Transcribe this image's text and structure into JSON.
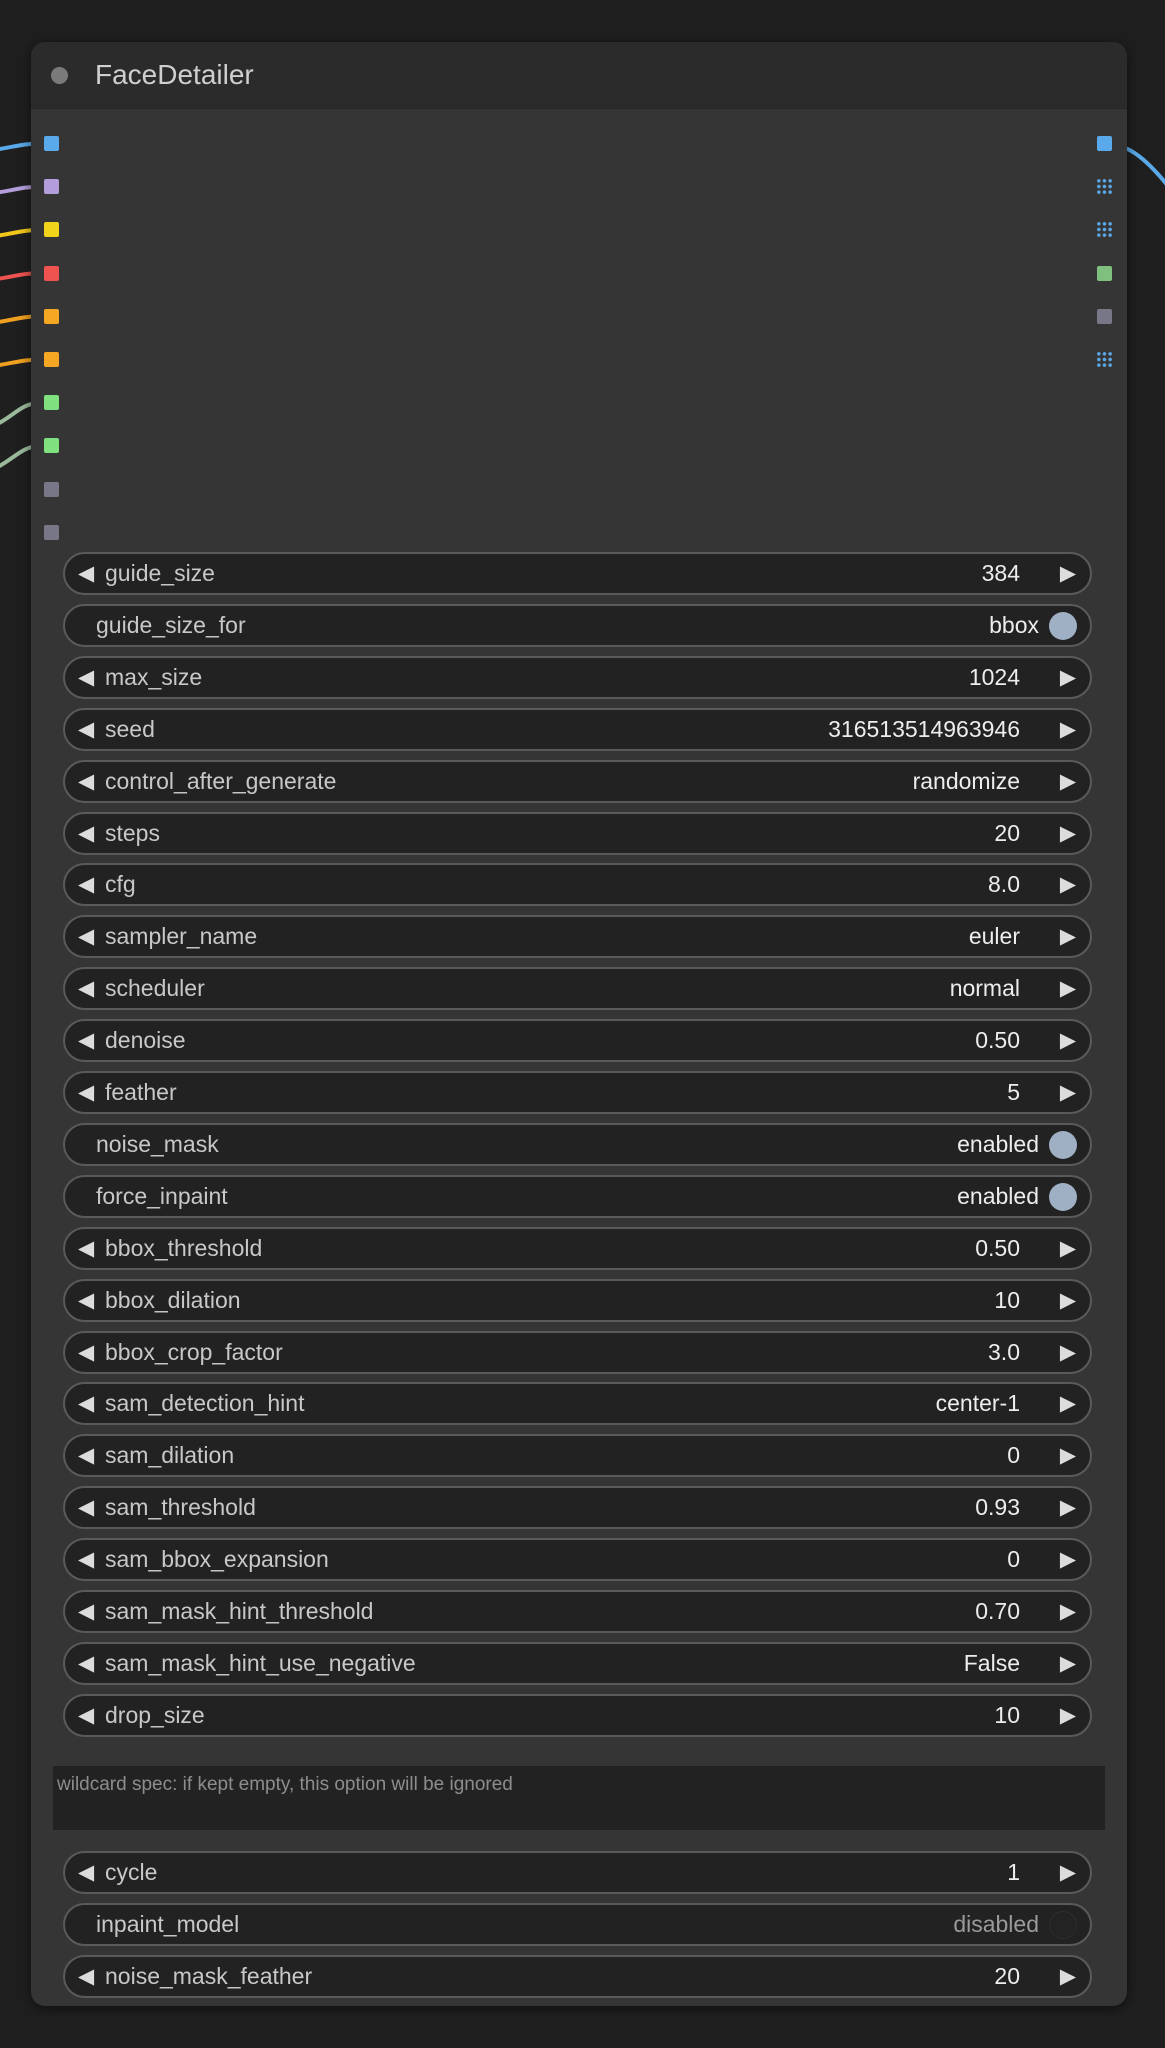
{
  "node": {
    "title": "FaceDetailer"
  },
  "colors": {
    "node_bg": "#353535",
    "header_bg": "#2b2b2b",
    "widget_bg": "#222222",
    "widget_border": "#5a5a5a",
    "toggle_on": "#9fb0c4",
    "canvas_bg": "#1f1f1f"
  },
  "input_slots": [
    {
      "color": "#5aa9ea",
      "wire": "#5aa9ea"
    },
    {
      "color": "#b39ddb",
      "wire": "#b39ddb"
    },
    {
      "color": "#f2d31b",
      "wire": "#f2c61b"
    },
    {
      "color": "#ef5350",
      "wire": "#ef5350"
    },
    {
      "color": "#f5a623",
      "wire": "#f0a020"
    },
    {
      "color": "#f5a623",
      "wire": "#f0a020"
    },
    {
      "color": "#7fe07f",
      "wire": "#9ab89a"
    },
    {
      "color": "#7fe07f",
      "wire": "#9ab89a"
    },
    {
      "color": "#777788",
      "wire": null
    },
    {
      "color": "#777788",
      "wire": null
    }
  ],
  "output_slots": [
    {
      "color": "#5aa9ea",
      "shape": "square",
      "wire": "#5aa9ea"
    },
    {
      "color": "#5aa9ea",
      "shape": "grid",
      "wire": null
    },
    {
      "color": "#5aa9ea",
      "shape": "grid",
      "wire": null
    },
    {
      "color": "#7fc07f",
      "shape": "square",
      "wire": null
    },
    {
      "color": "#777788",
      "shape": "square",
      "wire": null
    },
    {
      "color": "#5aa9ea",
      "shape": "grid",
      "wire": null
    }
  ],
  "arrows": {
    "left": "◀",
    "right": "▶"
  },
  "widgets": [
    {
      "label": "guide_size",
      "value": "384",
      "kind": "number"
    },
    {
      "label": "guide_size_for",
      "value": "bbox",
      "kind": "toggle",
      "on": true
    },
    {
      "label": "max_size",
      "value": "1024",
      "kind": "number"
    },
    {
      "label": "seed",
      "value": "316513514963946",
      "kind": "number"
    },
    {
      "label": "control_after_generate",
      "value": "randomize",
      "kind": "combo"
    },
    {
      "label": "steps",
      "value": "20",
      "kind": "number"
    },
    {
      "label": "cfg",
      "value": "8.0",
      "kind": "number"
    },
    {
      "label": "sampler_name",
      "value": "euler",
      "kind": "combo"
    },
    {
      "label": "scheduler",
      "value": "normal",
      "kind": "combo"
    },
    {
      "label": "denoise",
      "value": "0.50",
      "kind": "number"
    },
    {
      "label": "feather",
      "value": "5",
      "kind": "number"
    },
    {
      "label": "noise_mask",
      "value": "enabled",
      "kind": "toggle",
      "on": true
    },
    {
      "label": "force_inpaint",
      "value": "enabled",
      "kind": "toggle",
      "on": true
    },
    {
      "label": "bbox_threshold",
      "value": "0.50",
      "kind": "number"
    },
    {
      "label": "bbox_dilation",
      "value": "10",
      "kind": "number"
    },
    {
      "label": "bbox_crop_factor",
      "value": "3.0",
      "kind": "number"
    },
    {
      "label": "sam_detection_hint",
      "value": "center-1",
      "kind": "combo"
    },
    {
      "label": "sam_dilation",
      "value": "0",
      "kind": "number"
    },
    {
      "label": "sam_threshold",
      "value": "0.93",
      "kind": "number"
    },
    {
      "label": "sam_bbox_expansion",
      "value": "0",
      "kind": "number"
    },
    {
      "label": "sam_mask_hint_threshold",
      "value": "0.70",
      "kind": "number"
    },
    {
      "label": "sam_mask_hint_use_negative",
      "value": "False",
      "kind": "combo"
    },
    {
      "label": "drop_size",
      "value": "10",
      "kind": "number"
    }
  ],
  "wildcard": {
    "placeholder": "wildcard spec: if kept empty, this option will be ignored"
  },
  "widgets_after": [
    {
      "label": "cycle",
      "value": "1",
      "kind": "number"
    },
    {
      "label": "inpaint_model",
      "value": "disabled",
      "kind": "toggle",
      "on": false
    },
    {
      "label": "noise_mask_feather",
      "value": "20",
      "kind": "number"
    }
  ]
}
